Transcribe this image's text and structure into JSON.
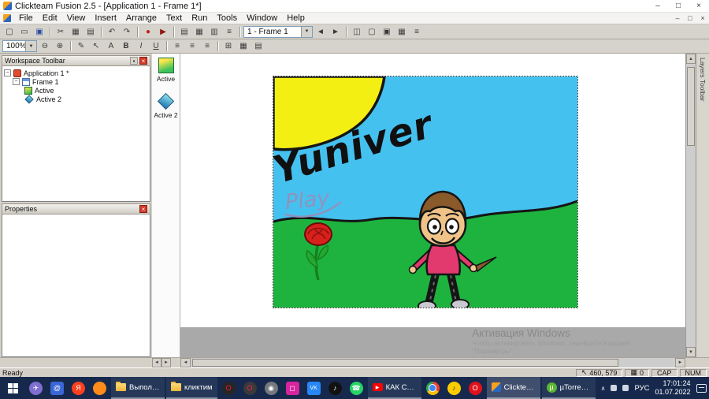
{
  "window": {
    "title": "Clickteam Fusion 2.5 - [Application 1 - Frame 1*]",
    "minimize": "–",
    "maximize": "□",
    "close": "×"
  },
  "child_window": {
    "minimize": "–",
    "restore": "□",
    "close": "×"
  },
  "menu": {
    "items": [
      "File",
      "Edit",
      "View",
      "Insert",
      "Arrange",
      "Text",
      "Run",
      "Tools",
      "Window",
      "Help"
    ]
  },
  "ui": {
    "dropdown": "▼",
    "left": "◄",
    "right": "►",
    "up": "▲",
    "down": "▼",
    "pin": "▪",
    "close_small": "×",
    "collapse": "−"
  },
  "toolbar1": {
    "icons": [
      {
        "name": "new-document-icon",
        "glyph": "▢"
      },
      {
        "name": "open-icon",
        "glyph": "▭"
      },
      {
        "name": "save-icon",
        "glyph": "▣",
        "color": "#2b4fa0"
      },
      {
        "name": "cut-icon",
        "glyph": "✂"
      },
      {
        "name": "copy-icon",
        "glyph": "▦"
      },
      {
        "name": "paste-icon",
        "glyph": "▤"
      },
      {
        "name": "undo-icon",
        "glyph": "↶"
      },
      {
        "name": "redo-icon",
        "glyph": "↷"
      },
      {
        "name": "stop-icon",
        "glyph": "●",
        "color": "#c22015"
      },
      {
        "name": "run-application-icon",
        "glyph": "▶",
        "color": "#8f180e"
      },
      {
        "name": "storyboard-editor-icon",
        "glyph": "▤"
      },
      {
        "name": "frame-editor-icon",
        "glyph": "▦"
      },
      {
        "name": "event-editor-icon",
        "glyph": "▥"
      },
      {
        "name": "event-list-editor-icon",
        "glyph": "≡"
      }
    ],
    "frame_selector": "1 - Frame 1",
    "icons_right": [
      {
        "name": "data-elements-icon",
        "glyph": "◫"
      },
      {
        "name": "monitor-icon",
        "glyph": "▢"
      },
      {
        "name": "debugger-icon",
        "glyph": "▣"
      },
      {
        "name": "grid-options-icon",
        "glyph": "▦"
      },
      {
        "name": "menu-options-icon",
        "glyph": "≡"
      }
    ]
  },
  "toolbar2": {
    "zoom": "100%",
    "icons": [
      {
        "name": "zoom-out-icon",
        "glyph": "⊖"
      },
      {
        "name": "zoom-in-icon",
        "glyph": "⊕"
      },
      {
        "name": "pencil-icon",
        "glyph": "✎"
      },
      {
        "name": "select-tool-icon",
        "glyph": "↖"
      },
      {
        "name": "text-tool-icon",
        "glyph": "A"
      },
      {
        "name": "bold-icon",
        "glyph": "B"
      },
      {
        "name": "italic-icon",
        "glyph": "I"
      },
      {
        "name": "underline-icon",
        "glyph": "U"
      },
      {
        "name": "align-left-icon",
        "glyph": "≡"
      },
      {
        "name": "align-center-icon",
        "glyph": "≡"
      },
      {
        "name": "align-right-icon",
        "glyph": "≡"
      },
      {
        "name": "center-frame-icon",
        "glyph": "⊞"
      },
      {
        "name": "grid-icon",
        "glyph": "▦"
      },
      {
        "name": "snap-to-grid-icon",
        "glyph": "▤"
      }
    ]
  },
  "workspace": {
    "title": "Workspace Toolbar",
    "tree": [
      {
        "label": "Application 1 *"
      },
      {
        "label": "Frame 1"
      },
      {
        "label": "Active"
      },
      {
        "label": "Active 2"
      }
    ]
  },
  "properties": {
    "title": "Properties"
  },
  "objects_panel": {
    "items": [
      {
        "label": "Active"
      },
      {
        "label": "Active 2"
      }
    ]
  },
  "layers_panel": {
    "title": "Layers Toolbar"
  },
  "drawing": {
    "title_text": "Yuniver",
    "play_text": "Play"
  },
  "activation": {
    "line1": "Активация Windows",
    "line2": "Чтобы активировать Windows, перейдите в раздел",
    "line3": "\"Параметры\"."
  },
  "statusbar": {
    "ready": "Ready",
    "pointer_icon": "↖",
    "coords": "460, 579",
    "grid_icon": "▦",
    "count": "0",
    "caps": "CAP",
    "num": "NUM"
  },
  "taskbar": {
    "items": [
      {
        "type": "app",
        "name": "telegram",
        "glyph": "✈",
        "bg": "#7d6ed0",
        "fg": "#ffffff"
      },
      {
        "type": "app",
        "name": "mail-app",
        "glyph": "@",
        "bg": "#3a66d6",
        "fg": "#ffffff"
      },
      {
        "type": "app",
        "name": "yandex-browser",
        "glyph": "Я",
        "bg": "#fc3f1d",
        "fg": "#ffffff"
      },
      {
        "type": "app",
        "name": "firefox",
        "glyph": "",
        "bg": "#ff8c1a",
        "fg": "#ffffff"
      },
      {
        "type": "window",
        "name": "explorer-window",
        "label": "Выполне...",
        "icon": "folder"
      },
      {
        "type": "window",
        "name": "folder-window",
        "label": "кликтим",
        "icon": "folder"
      },
      {
        "type": "app",
        "name": "opera",
        "glyph": "O",
        "bg": "#262626",
        "fg": "#ff1b2d"
      },
      {
        "type": "app",
        "name": "opera-gx",
        "glyph": "O",
        "bg": "#3a3a3a",
        "fg": "#fa1e4e"
      },
      {
        "type": "app",
        "name": "camera",
        "glyph": "◉",
        "bg": "#75787e",
        "fg": "#ffffff"
      },
      {
        "type": "app",
        "name": "instagram",
        "glyph": "◻",
        "bg": "#d6249f",
        "fg": "#ffffff"
      },
      {
        "type": "app",
        "name": "vk",
        "glyph": "VK",
        "bg": "#2787f5",
        "fg": "#ffffff"
      },
      {
        "type": "app",
        "name": "tiktok",
        "glyph": "♪",
        "bg": "#121212",
        "fg": "#ffffff"
      },
      {
        "type": "app",
        "name": "whatsapp",
        "glyph": "☎",
        "bg": "#25d366",
        "fg": "#ffffff"
      },
      {
        "type": "window",
        "name": "youtube-window",
        "label": "КАК СОЗ...",
        "icon": "youtube",
        "icon_glyph": "▶"
      },
      {
        "type": "app",
        "name": "chrome",
        "glyph": "",
        "bg": "",
        "fg": "#ffffff"
      },
      {
        "type": "app",
        "name": "yandex-music",
        "glyph": "♪",
        "bg": "#ffcc00",
        "fg": "#333333"
      },
      {
        "type": "app",
        "name": "opera-browser",
        "glyph": "O",
        "bg": "#e1111c",
        "fg": "#ffffff"
      },
      {
        "type": "window",
        "name": "clickteam-window",
        "label": "Clickteam...",
        "icon": "fusion",
        "active": true
      },
      {
        "type": "window",
        "name": "utorrent-window",
        "label": "µTorrent ...",
        "icon": "utorrent",
        "icon_glyph": "µ"
      }
    ],
    "tray": {
      "chevron": "∧",
      "lang": "РУС",
      "time": "17:01:24",
      "date": "01.07.2022"
    }
  }
}
